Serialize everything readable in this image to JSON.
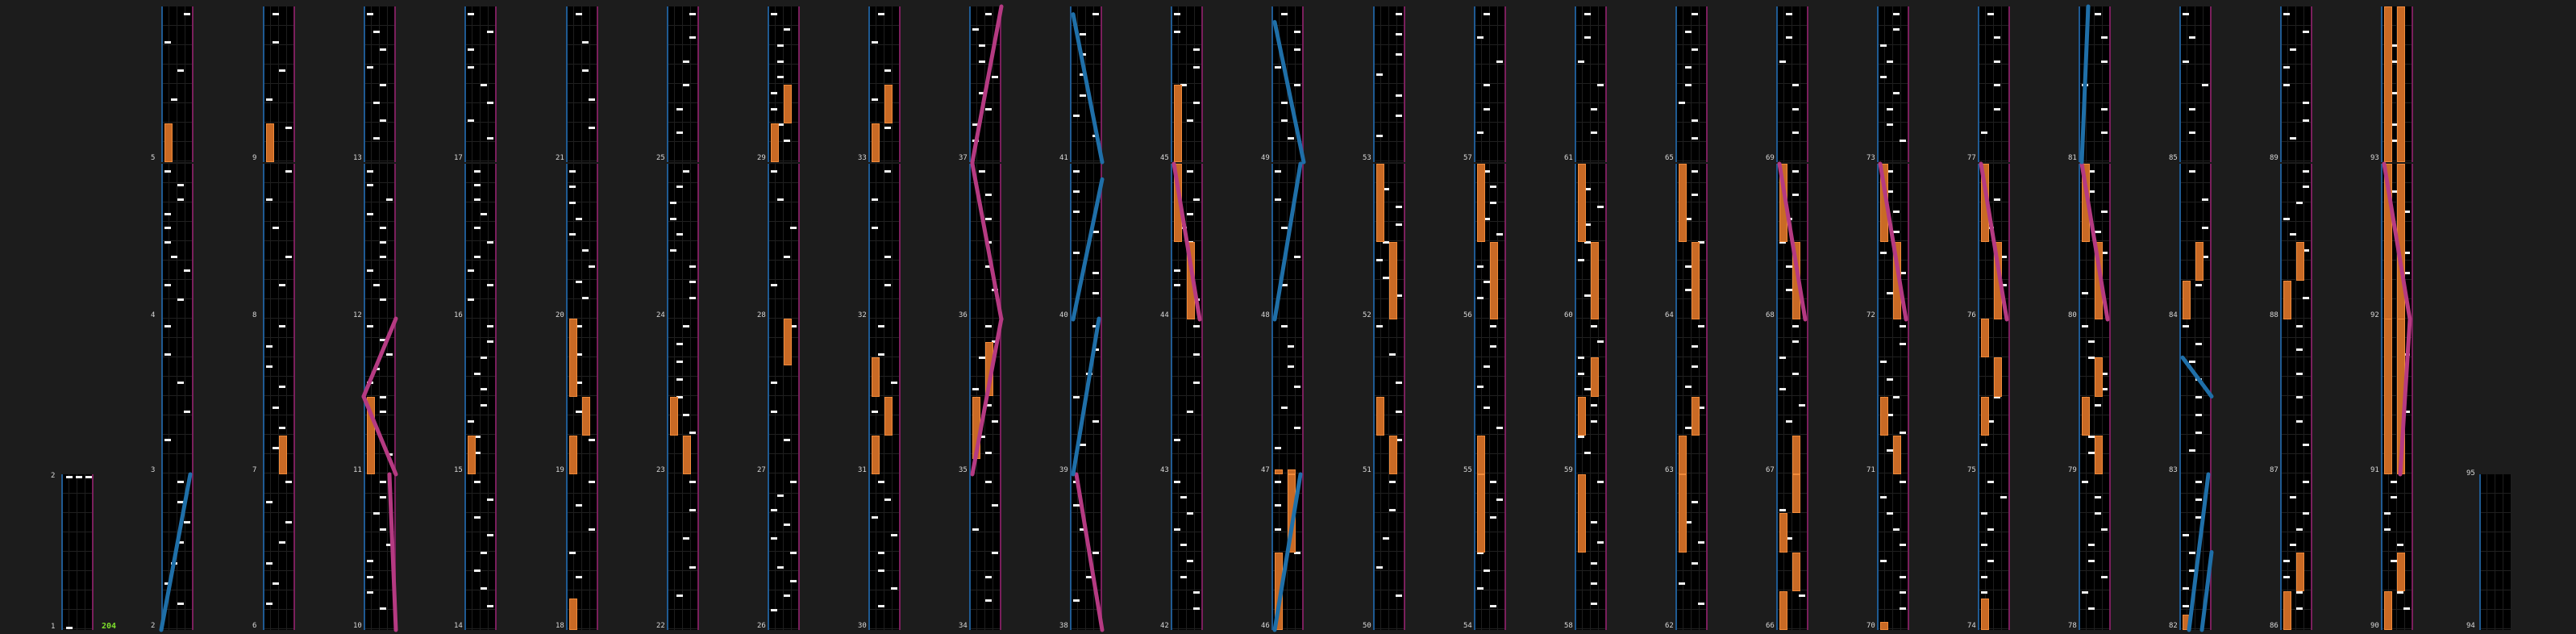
{
  "chart": {
    "measure_labels": [
      "1",
      "2",
      "3",
      "4",
      "5",
      "6",
      "7",
      "8",
      "9",
      "10",
      "11",
      "12",
      "13",
      "14",
      "15",
      "16",
      "17",
      "18",
      "19",
      "20",
      "21",
      "22",
      "23",
      "24",
      "25",
      "26",
      "27",
      "28",
      "29",
      "30",
      "31",
      "32",
      "33",
      "34",
      "35",
      "36",
      "37",
      "38",
      "39",
      "40",
      "41",
      "42",
      "43",
      "44",
      "45",
      "46",
      "47",
      "48",
      "49",
      "50",
      "51",
      "52",
      "53",
      "54",
      "55",
      "56",
      "57",
      "58",
      "59",
      "60",
      "61",
      "62",
      "63",
      "64",
      "65",
      "66",
      "67",
      "68",
      "69",
      "70",
      "71",
      "72",
      "73",
      "74",
      "75",
      "76",
      "77",
      "78",
      "79",
      "80",
      "81",
      "82",
      "83",
      "84",
      "85",
      "86",
      "87",
      "88",
      "89",
      "90",
      "91",
      "92",
      "93",
      "94",
      "95"
    ],
    "combo": "204",
    "colors": {
      "background": "#1c1c1c",
      "lane": "#000000",
      "hold": "#c96a25",
      "slide_blue": "#1f6fa8",
      "slide_pink": "#b53a82",
      "combo": "#7ee02c"
    }
  }
}
